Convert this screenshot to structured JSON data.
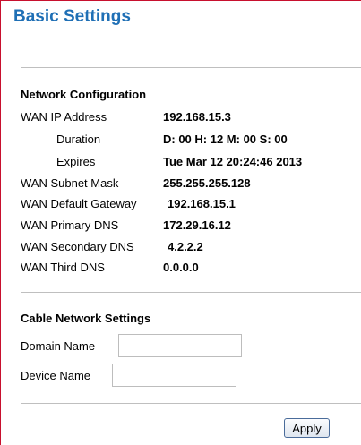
{
  "page_title": "Basic Settings",
  "network_configuration": {
    "heading": "Network Configuration",
    "rows": [
      {
        "label": "WAN IP Address",
        "value": "192.168.15.3"
      },
      {
        "label": "Duration",
        "value": "D: 00 H: 12 M: 00 S: 00"
      },
      {
        "label": "Expires",
        "value": "Tue Mar 12 20:24:46 2013"
      },
      {
        "label": "WAN Subnet Mask",
        "value": "255.255.255.128"
      },
      {
        "label": "WAN Default Gateway",
        "value": "192.168.15.1"
      },
      {
        "label": "WAN Primary DNS",
        "value": "172.29.16.12"
      },
      {
        "label": "WAN Secondary DNS",
        "value": "4.2.2.2"
      },
      {
        "label": "WAN Third DNS",
        "value": "0.0.0.0"
      }
    ]
  },
  "cable_network_settings": {
    "heading": "Cable Network Settings",
    "domain_name": {
      "label": "Domain Name",
      "value": ""
    },
    "device_name": {
      "label": "Device Name",
      "value": ""
    }
  },
  "actions": {
    "apply_label": "Apply"
  },
  "colors": {
    "title": "#1f6fb5",
    "frame_border": "#c8102e",
    "divider": "#bfbfbf"
  }
}
